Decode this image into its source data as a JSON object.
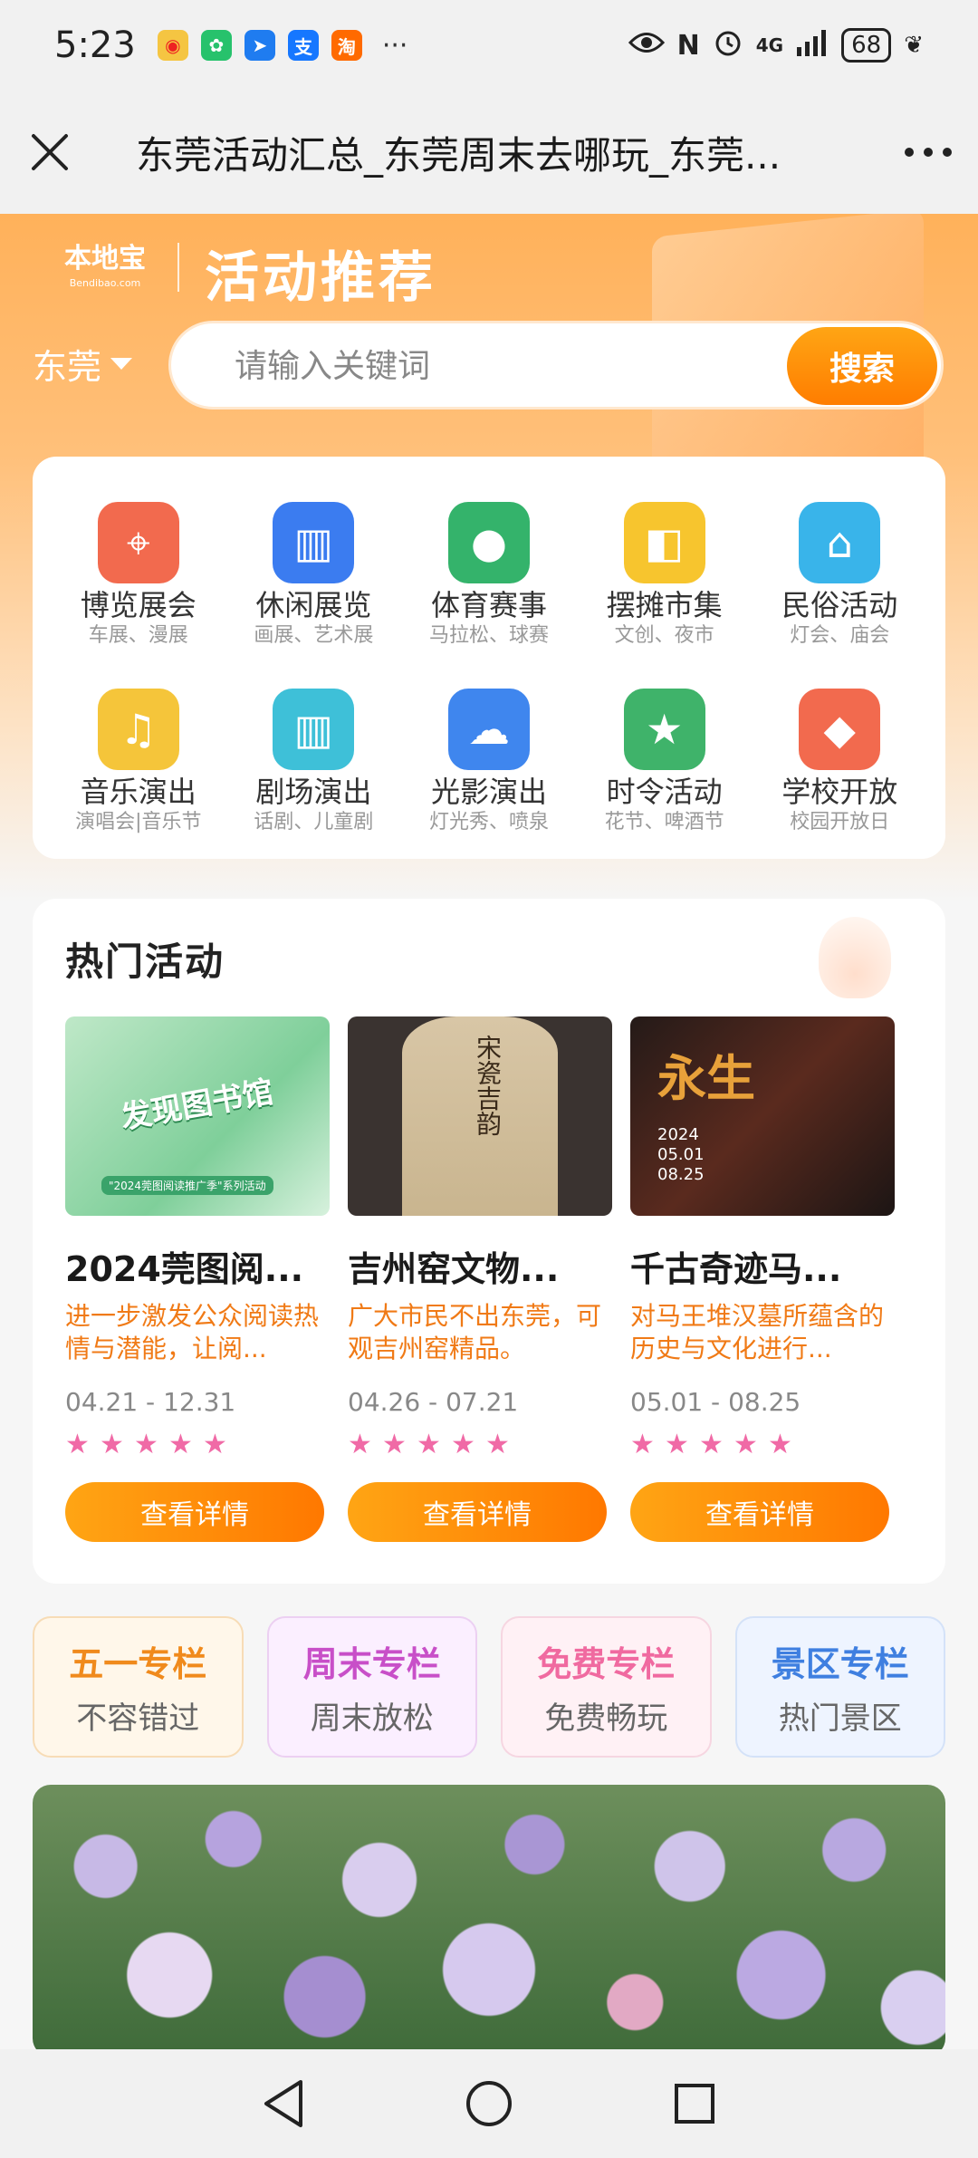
{
  "status": {
    "time": "5:23",
    "more": "···",
    "network": "4G",
    "battery": "68"
  },
  "title": {
    "text": "东莞活动汇总_东莞周末去哪玩_东莞..."
  },
  "hero": {
    "logo": "本地宝",
    "logo_sub": "Bendibao.com",
    "title": "活动推荐",
    "city": "东莞",
    "search_placeholder": "请输入关键词",
    "search_button": "搜索"
  },
  "categories": [
    {
      "name": "博览展会",
      "sub": "车展、漫展",
      "color": "#f26a4e",
      "icon": "map-icon"
    },
    {
      "name": "休闲展览",
      "sub": "画展、艺术展",
      "color": "#3b7cf0",
      "icon": "building-icon"
    },
    {
      "name": "体育赛事",
      "sub": "马拉松、球赛",
      "color": "#34b36b",
      "icon": "pingpong-icon"
    },
    {
      "name": "摆摊市集",
      "sub": "文创、夜市",
      "color": "#f7c52e",
      "icon": "shopping-bag-icon"
    },
    {
      "name": "民俗活动",
      "sub": "灯会、庙会",
      "color": "#39b4ea",
      "icon": "house-icon"
    },
    {
      "name": "音乐演出",
      "sub": "演唱会|音乐节",
      "color": "#f5c53a",
      "icon": "music-note-icon"
    },
    {
      "name": "剧场演出",
      "sub": "话剧、儿童剧",
      "color": "#3ec0d8",
      "icon": "theater-icon"
    },
    {
      "name": "光影演出",
      "sub": "灯光秀、喷泉",
      "color": "#3f86ee",
      "icon": "fountain-icon"
    },
    {
      "name": "时令活动",
      "sub": "花节、啤酒节",
      "color": "#3fb36a",
      "icon": "star-bookmark-icon"
    },
    {
      "name": "学校开放",
      "sub": "校园开放日",
      "color": "#f26a4e",
      "icon": "graduation-cap-icon"
    }
  ],
  "hot": {
    "title": "热门活动",
    "cards": [
      {
        "title": "2024莞图阅...",
        "desc": "进一步激发公众阅读热情与潜能，让阅...",
        "date": "04.21 - 12.31",
        "rating": 5,
        "button": "查看详情",
        "thumb_text": "发现图书馆",
        "thumb_caption": "\"2024莞图阅读推广季\"系列活动"
      },
      {
        "title": "吉州窑文物...",
        "desc": "广大市民不出东莞，可观吉州窑精品。",
        "date": "04.26 - 07.21",
        "rating": 5,
        "button": "查看详情",
        "thumb_text": "宋瓷吉韵"
      },
      {
        "title": "千古奇迹马...",
        "desc": "对马王堆汉墓所蕴含的历史与文化进行...",
        "date": "05.01 - 08.25",
        "rating": 5,
        "button": "查看详情",
        "thumb_text": "永生",
        "thumb_dates": "2024 05.01 08.25"
      }
    ]
  },
  "columns": [
    {
      "title": "五一专栏",
      "sub": "不容错过",
      "title_color": "#f08a1c",
      "bg": "#fff7ea",
      "border": "#f7dcb6"
    },
    {
      "title": "周末专栏",
      "sub": "周末放松",
      "title_color": "#c84fc8",
      "bg": "#fbefff",
      "border": "#ecd0f2"
    },
    {
      "title": "免费专栏",
      "sub": "免费畅玩",
      "title_color": "#f06aa0",
      "bg": "#fff1f5",
      "border": "#f6d6e1"
    },
    {
      "title": "景区专栏",
      "sub": "热门景区",
      "title_color": "#3f7fe0",
      "bg": "#eef4ff",
      "border": "#d4e2f8"
    }
  ]
}
